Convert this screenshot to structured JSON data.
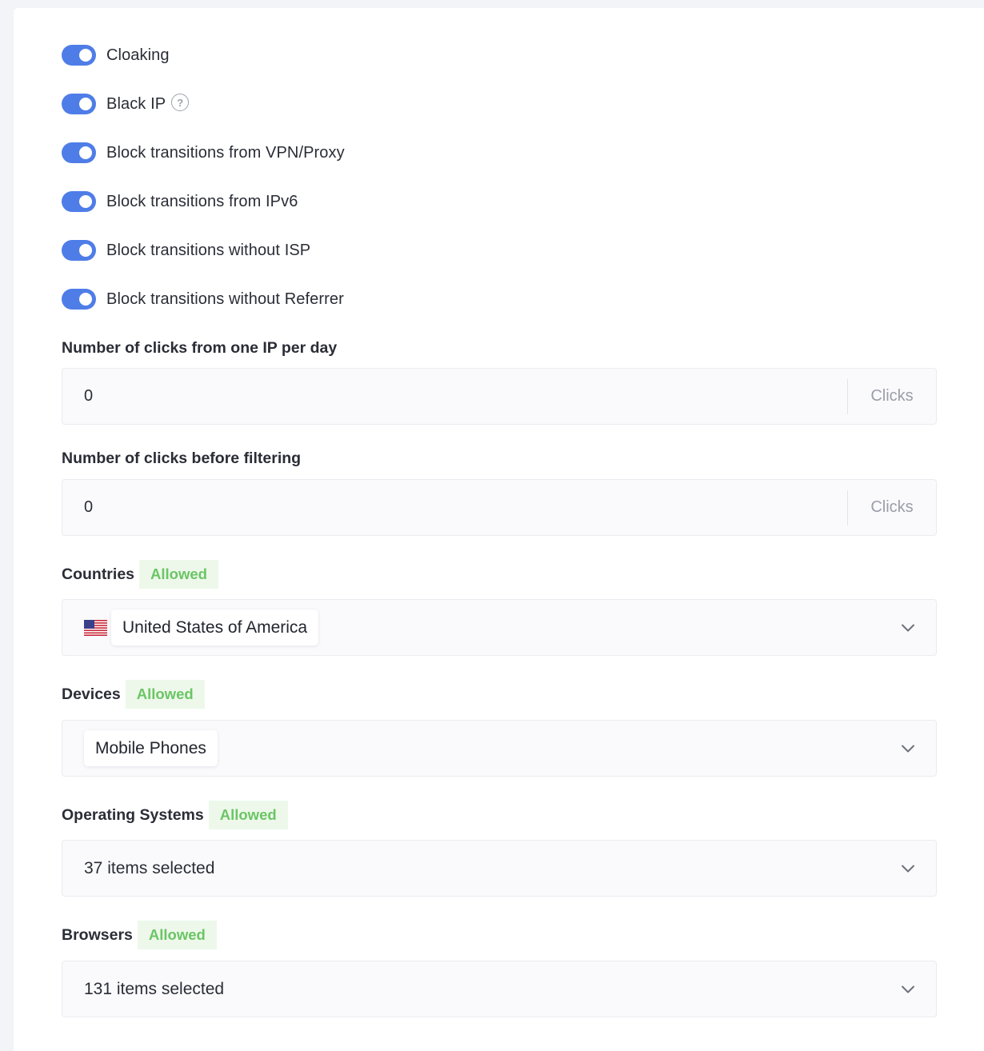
{
  "toggles": [
    {
      "label": "Cloaking",
      "on": true
    },
    {
      "label": "Black IP",
      "on": true,
      "help_icon": "question-circle-icon"
    },
    {
      "label": "Block transitions from VPN/Proxy",
      "on": true
    },
    {
      "label": "Block transitions from IPv6",
      "on": true
    },
    {
      "label": "Block transitions without ISP",
      "on": true
    },
    {
      "label": "Block transitions without Referrer",
      "on": true
    }
  ],
  "clicks_per_ip": {
    "label": "Number of clicks from one IP per day",
    "value": "0",
    "suffix": "Clicks"
  },
  "clicks_before_filtering": {
    "label": "Number of clicks before filtering",
    "value": "0",
    "suffix": "Clicks"
  },
  "countries": {
    "label": "Countries",
    "badge": "Allowed",
    "selected": [
      "United States of America"
    ],
    "flag_icon": "us-flag-icon"
  },
  "devices": {
    "label": "Devices",
    "badge": "Allowed",
    "selected": [
      "Mobile Phones"
    ]
  },
  "operating_systems": {
    "label": "Operating Systems",
    "badge": "Allowed",
    "summary": "37 items selected"
  },
  "browsers": {
    "label": "Browsers",
    "badge": "Allowed",
    "summary": "131 items selected"
  },
  "colors": {
    "toggle_on": "#4f7de8",
    "badge_bg": "#edf8ea",
    "badge_text": "#6bc565"
  }
}
